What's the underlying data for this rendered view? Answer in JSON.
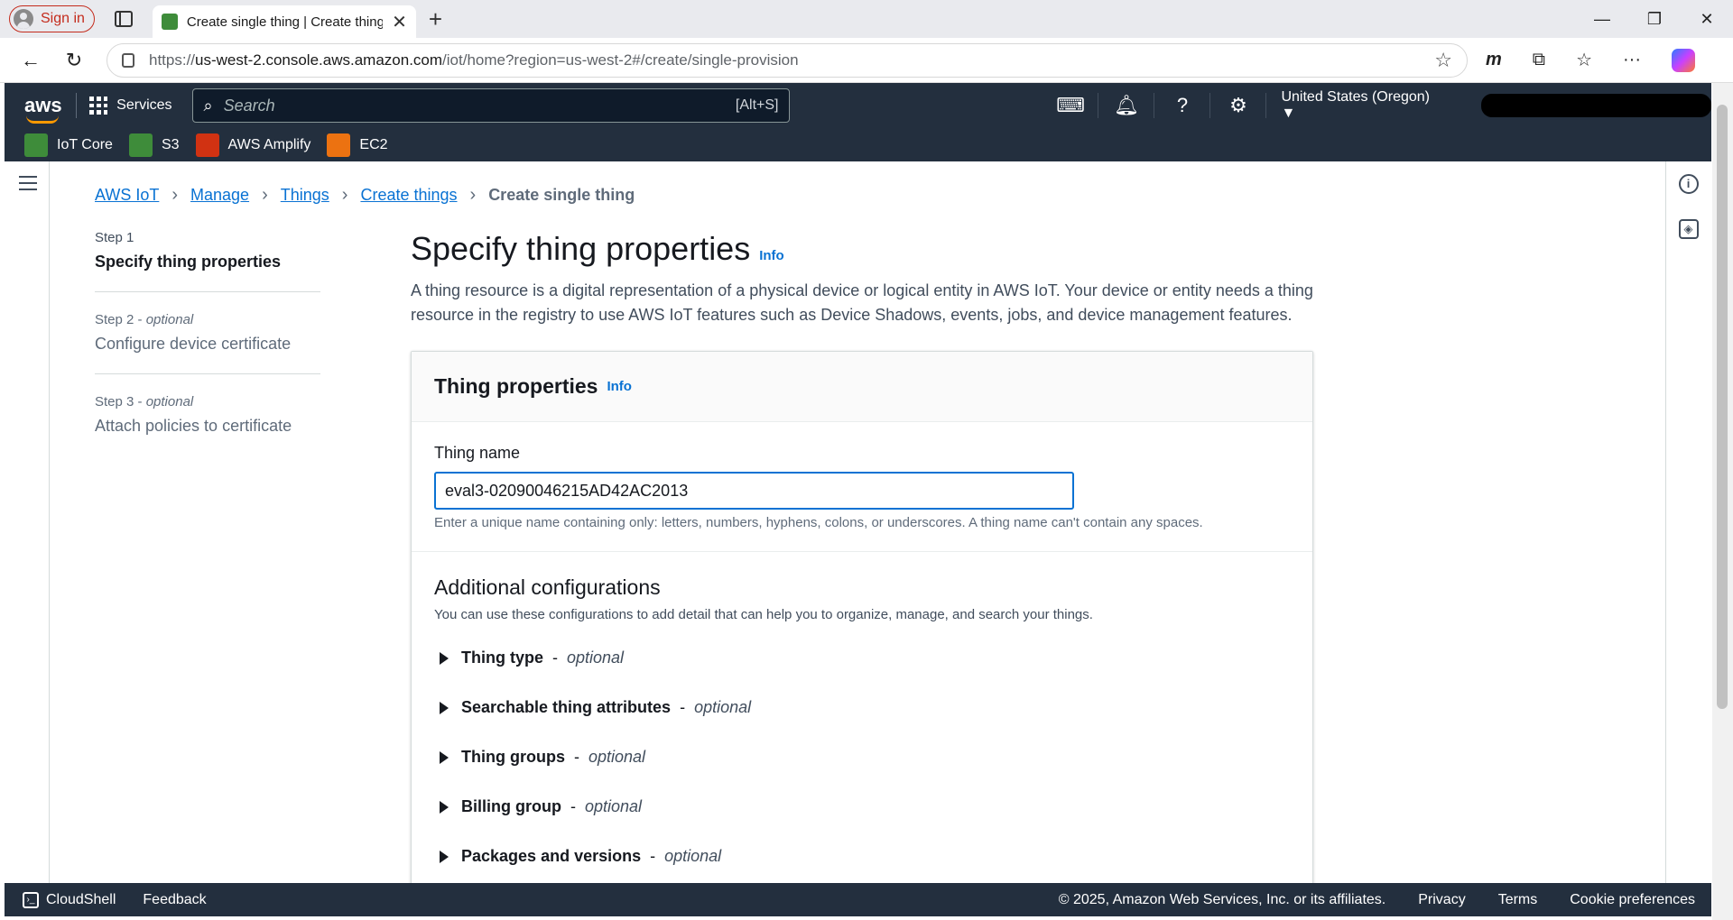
{
  "browser": {
    "signin_label": "Sign in",
    "tab_title": "Create single thing | Create things",
    "url_prefix": "https://",
    "url_host": "us-west-2.console.aws.amazon.com",
    "url_path": "/iot/home?region=us-west-2#/create/single-provision"
  },
  "aws_header": {
    "logo": "aws",
    "services_label": "Services",
    "search_placeholder": "Search",
    "search_shortcut": "[Alt+S]",
    "region": "United States (Oregon) ▼",
    "favorites": [
      {
        "label": "IoT Core",
        "color": "#3e8c3a"
      },
      {
        "label": "S3",
        "color": "#3e8c3a"
      },
      {
        "label": "AWS Amplify",
        "color": "#d13212"
      },
      {
        "label": "EC2",
        "color": "#ec7211"
      }
    ]
  },
  "breadcrumb": {
    "items": [
      "AWS IoT",
      "Manage",
      "Things",
      "Create things"
    ],
    "current": "Create single thing"
  },
  "steps": [
    {
      "step": "Step 1",
      "optional": "",
      "name": "Specify thing properties"
    },
    {
      "step": "Step 2 - ",
      "optional": "optional",
      "name": "Configure device certificate"
    },
    {
      "step": "Step 3 - ",
      "optional": "optional",
      "name": "Attach policies to certificate"
    }
  ],
  "main": {
    "title": "Specify thing properties",
    "info": "Info",
    "description": "A thing resource is a digital representation of a physical device or logical entity in AWS IoT. Your device or entity needs a thing resource in the registry to use AWS IoT features such as Device Shadows, events, jobs, and device management features."
  },
  "panel": {
    "title": "Thing properties",
    "info": "Info",
    "field_label": "Thing name",
    "field_value": "eval3-02090046215AD42AC2013",
    "field_hint": "Enter a unique name containing only: letters, numbers, hyphens, colons, or underscores. A thing name can't contain any spaces.",
    "addl_title": "Additional configurations",
    "addl_sub": "You can use these configurations to add detail that can help you to organize, manage, and search your things.",
    "sections": [
      {
        "label": "Thing type",
        "suffix": "optional"
      },
      {
        "label": "Searchable thing attributes",
        "suffix": "optional"
      },
      {
        "label": "Thing groups",
        "suffix": "optional"
      },
      {
        "label": "Billing group",
        "suffix": "optional"
      },
      {
        "label": "Packages and versions",
        "suffix": "optional"
      }
    ]
  },
  "footer": {
    "cloudshell": "CloudShell",
    "feedback": "Feedback",
    "copyright": "© 2025, Amazon Web Services, Inc. or its affiliates.",
    "privacy": "Privacy",
    "terms": "Terms",
    "cookies": "Cookie preferences"
  }
}
